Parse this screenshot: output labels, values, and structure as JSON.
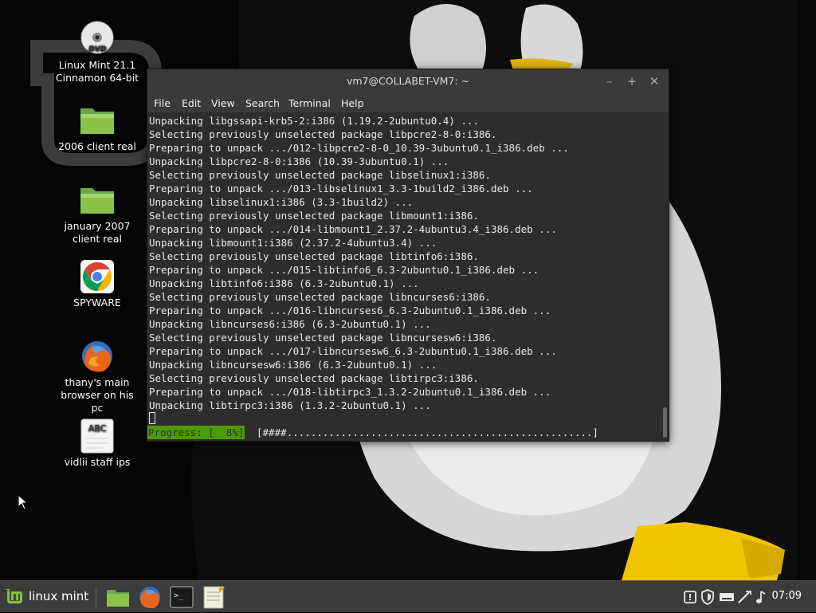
{
  "desktop": {
    "icons": [
      {
        "id": "dvd",
        "label_line1": "Linux Mint 21.1",
        "label_line2": "Cinnamon 64-bit",
        "icon": "dvd-icon"
      },
      {
        "id": "folder1",
        "label_line1": "2006 client real",
        "label_line2": "",
        "icon": "folder-icon"
      },
      {
        "id": "folder2",
        "label_line1": "january 2007",
        "label_line2": "client real",
        "icon": "folder-icon"
      },
      {
        "id": "chrome",
        "label_line1": "SPYWARE",
        "label_line2": "",
        "icon": "chrome-icon"
      },
      {
        "id": "firefox",
        "label_line1": "thany's main",
        "label_line2": "browser on his pc",
        "icon": "firefox-icon"
      },
      {
        "id": "textfile",
        "label_line1": "vidlii staff ips",
        "label_line2": "",
        "icon": "text-file-icon",
        "glyph_text": "ABC"
      }
    ]
  },
  "terminal": {
    "title": "vm7@COLLABET-VM7: ~",
    "menu": [
      "File",
      "Edit",
      "View",
      "Search",
      "Terminal",
      "Help"
    ],
    "lines": [
      "Unpacking libgssapi-krb5-2:i386 (1.19.2-2ubuntu0.4) ...",
      "Selecting previously unselected package libpcre2-8-0:i386.",
      "Preparing to unpack .../012-libpcre2-8-0_10.39-3ubuntu0.1_i386.deb ...",
      "Unpacking libpcre2-8-0:i386 (10.39-3ubuntu0.1) ...",
      "Selecting previously unselected package libselinux1:i386.",
      "Preparing to unpack .../013-libselinux1_3.3-1build2_i386.deb ...",
      "Unpacking libselinux1:i386 (3.3-1build2) ...",
      "Selecting previously unselected package libmount1:i386.",
      "Preparing to unpack .../014-libmount1_2.37.2-4ubuntu3.4_i386.deb ...",
      "Unpacking libmount1:i386 (2.37.2-4ubuntu3.4) ...",
      "Selecting previously unselected package libtinfo6:i386.",
      "Preparing to unpack .../015-libtinfo6_6.3-2ubuntu0.1_i386.deb ...",
      "Unpacking libtinfo6:i386 (6.3-2ubuntu0.1) ...",
      "Selecting previously unselected package libncurses6:i386.",
      "Preparing to unpack .../016-libncurses6_6.3-2ubuntu0.1_i386.deb ...",
      "Unpacking libncurses6:i386 (6.3-2ubuntu0.1) ...",
      "Selecting previously unselected package libncursesw6:i386.",
      "Preparing to unpack .../017-libncursesw6_6.3-2ubuntu0.1_i386.deb ...",
      "Unpacking libncursesw6:i386 (6.3-2ubuntu0.1) ...",
      "Selecting previously unselected package libtirpc3:i386.",
      "Preparing to unpack .../018-libtirpc3_1.3.2-2ubuntu0.1_i386.deb ...",
      "Unpacking libtirpc3:i386 (1.3.2-2ubuntu0.1) ..."
    ],
    "progress_label": "Progress: [  8%]",
    "progress_bar": "[####...................................................]",
    "progress_percent": 8,
    "colors": {
      "progress_bg": "#4e9a06",
      "text": "#e8e8e8",
      "background": "#2d2d2d"
    }
  },
  "panel": {
    "menu_label": "linux mint",
    "launchers": [
      "files-icon",
      "firefox-icon",
      "terminal-icon",
      "text-editor-icon"
    ],
    "tray": [
      "update-manager-icon",
      "shield-icon",
      "keyboard-icon",
      "network-icon",
      "sound-icon"
    ],
    "clock": "07:09"
  }
}
